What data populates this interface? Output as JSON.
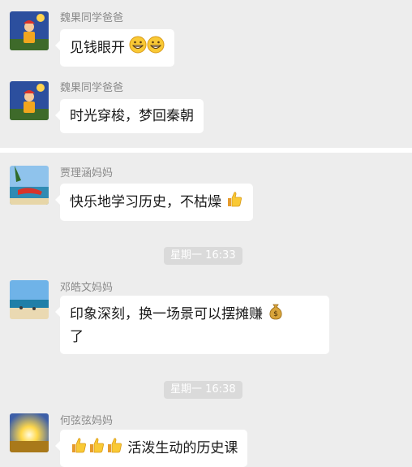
{
  "messages": [
    {
      "sender": "魏果同学爸爸",
      "text": "见钱眼开",
      "emoji": [
        "grinning-icon",
        "grinning-icon"
      ]
    },
    {
      "sender": "魏果同学爸爸",
      "text": "时光穿梭，梦回秦朝"
    },
    {
      "sender": "贾理涵妈妈",
      "text": "快乐地学习历史，不枯燥",
      "emoji": [
        "thumbs-up-icon"
      ]
    },
    {
      "sender": "邓皓文妈妈",
      "text_line1": "印象深刻，换一场景可以摆摊赚",
      "text_line2": "了",
      "emoji": [
        "money-bag-icon"
      ]
    },
    {
      "sender": "何弦弦妈妈",
      "text": "活泼生动的历史课",
      "emoji": [
        "thumbs-up-icon",
        "thumbs-up-icon",
        "thumbs-up-icon"
      ]
    }
  ],
  "timestamps": [
    "星期一 16:33",
    "星期一 16:38"
  ],
  "colors": {
    "background": "#ededed",
    "bubble": "#ffffff",
    "timestamp_pill": "#dadada",
    "sender_text": "#8a8a8a"
  }
}
